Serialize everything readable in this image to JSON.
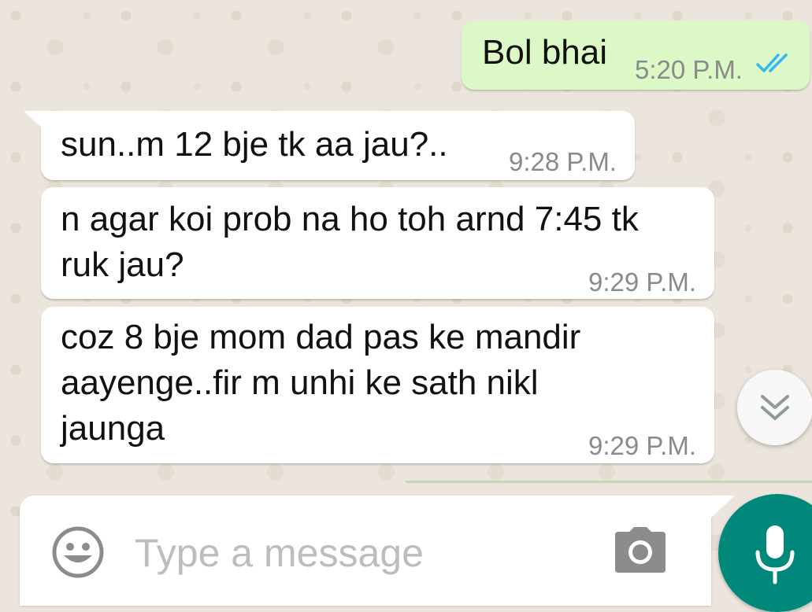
{
  "messages": [
    {
      "direction": "outgoing",
      "text": "Bol bhai",
      "time": "5:20 P.M.",
      "status": "read-double-tick-icon"
    },
    {
      "direction": "incoming",
      "text": "sun..m 12 bje tk aa jau?..",
      "time": "9:28 P.M."
    },
    {
      "direction": "incoming",
      "text": "n agar koi prob na ho toh arnd 7:45 tk\nruk jau?",
      "time": "9:29 P.M."
    },
    {
      "direction": "incoming",
      "text": "coz 8 bje mom dad pas ke mandir\naayenge..fir m unhi ke sath nikl\njaunga",
      "time": "9:29 P.M."
    }
  ],
  "composer": {
    "placeholder": "Type a message",
    "icons": [
      "emoji-icon",
      "camera-icon",
      "mic-icon"
    ]
  },
  "scroll_button": {
    "icon": "chevron-double-down-icon"
  },
  "colors": {
    "outgoing_bubble": "#DCF8C6",
    "incoming_bubble": "#FFFFFF",
    "wallpaper": "#ECE5DD",
    "read_ticks": "#34B7F1",
    "mic_button": "#00897B",
    "timestamp": "#8A8A8A"
  }
}
